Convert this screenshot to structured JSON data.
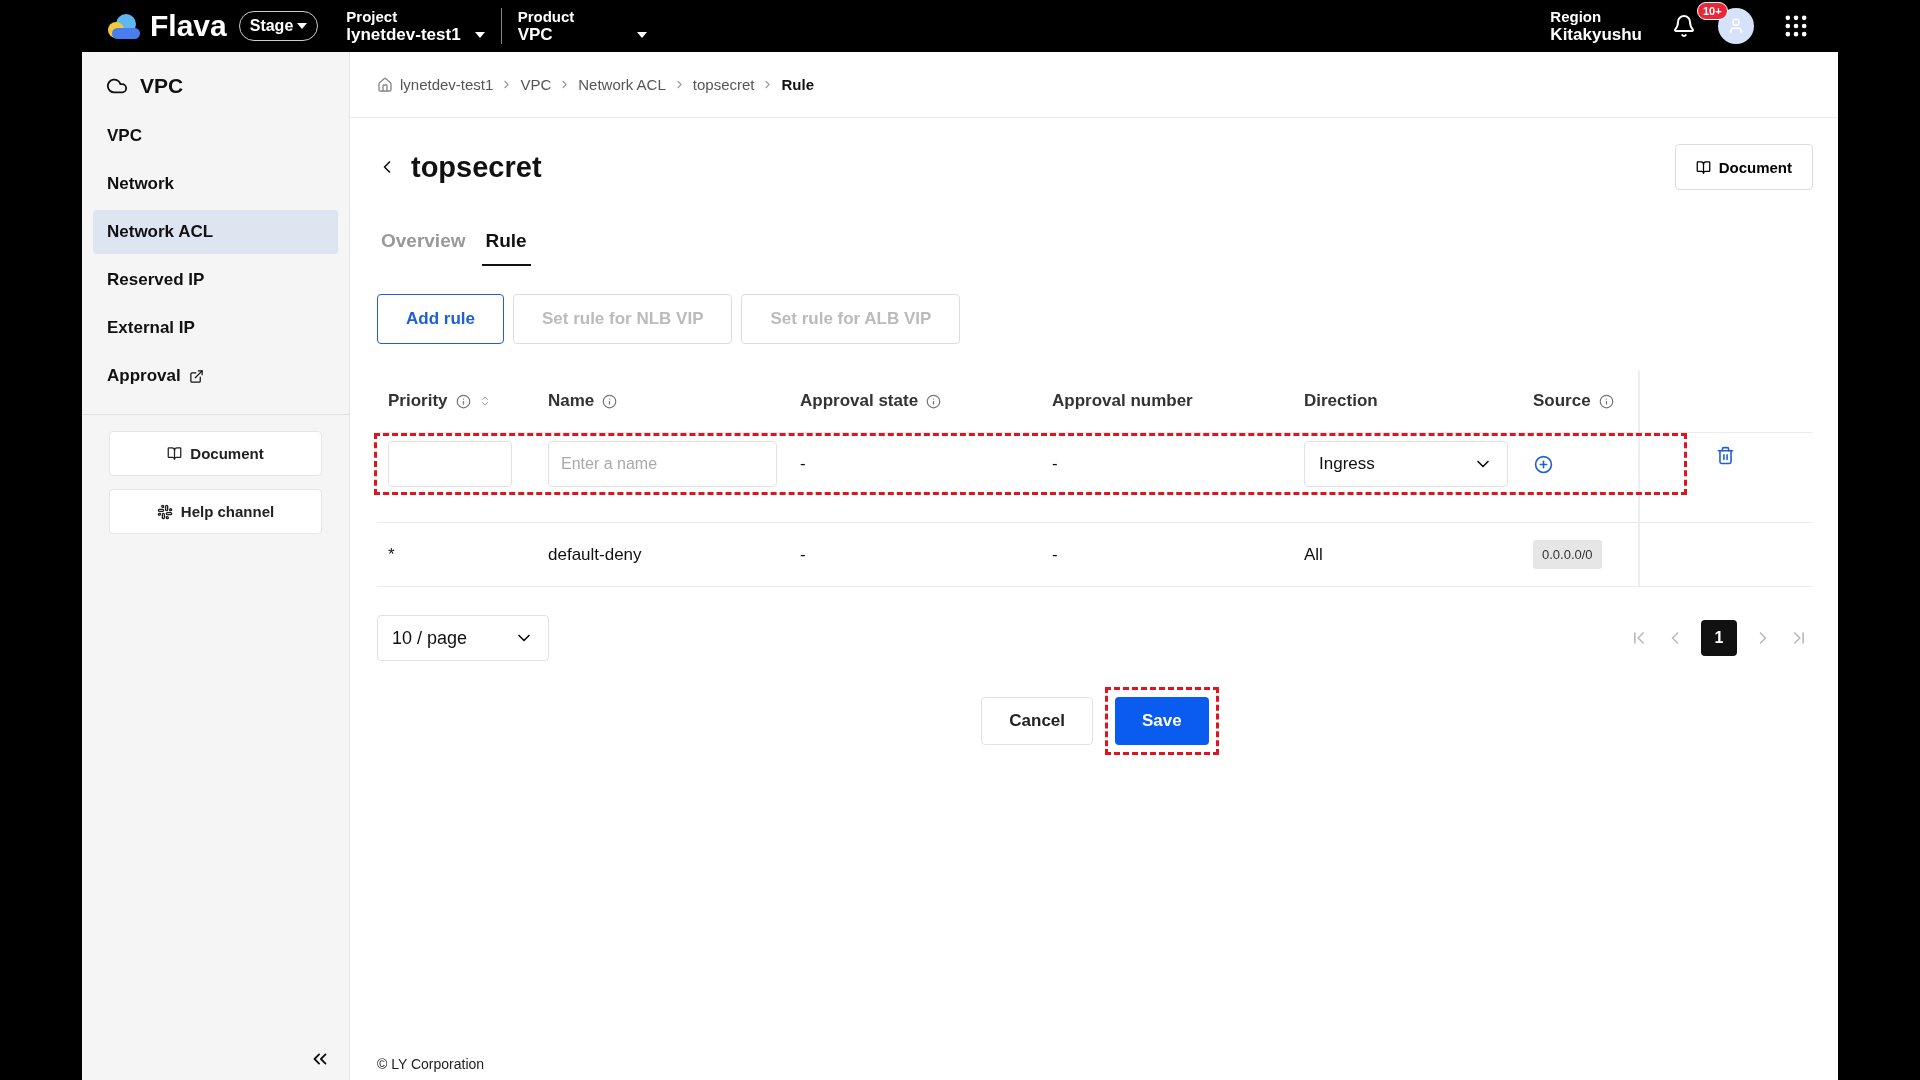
{
  "topbar": {
    "logo": "Flava",
    "env": "Stage",
    "project": {
      "label": "Project",
      "value": "lynetdev-test1"
    },
    "product": {
      "label": "Product",
      "value": "VPC"
    },
    "region": {
      "label": "Region",
      "value": "Kitakyushu"
    },
    "notifications": "10+"
  },
  "sidebar": {
    "title": "VPC",
    "items": [
      {
        "label": "VPC",
        "selected": false,
        "kind": "internal"
      },
      {
        "label": "Network",
        "selected": false,
        "kind": "internal"
      },
      {
        "label": "Network ACL",
        "selected": true,
        "kind": "internal"
      },
      {
        "label": "Reserved IP",
        "selected": false,
        "kind": "internal"
      },
      {
        "label": "External IP",
        "selected": false,
        "kind": "internal"
      },
      {
        "label": "Approval",
        "selected": false,
        "kind": "external"
      }
    ],
    "buttons": [
      {
        "kind": "doc",
        "label": "Document"
      },
      {
        "kind": "help",
        "label": "Help channel"
      }
    ]
  },
  "breadcrumb": [
    "lynetdev-test1",
    "VPC",
    "Network ACL",
    "topsecret",
    "Rule"
  ],
  "title": "topsecret",
  "document_button": "Document",
  "tabs": [
    {
      "label": "Overview",
      "selected": false
    },
    {
      "label": "Rule",
      "selected": true
    }
  ],
  "actions": [
    {
      "label": "Add rule",
      "disabled": false
    },
    {
      "label": "Set rule for NLB VIP",
      "disabled": true
    },
    {
      "label": "Set rule for ALB VIP",
      "disabled": true
    }
  ],
  "table": {
    "columns": [
      {
        "label": "Priority",
        "kind": "sortable"
      },
      {
        "label": "Name",
        "kind": "info"
      },
      {
        "label": "Approval state",
        "kind": "info"
      },
      {
        "label": "Approval number",
        "kind": "plain"
      },
      {
        "label": "Direction",
        "kind": "plain"
      },
      {
        "label": "Source",
        "kind": "info"
      }
    ],
    "rows": [
      {
        "kind": "edit",
        "highlighted": true,
        "name_placeholder": "Enter a name",
        "approval_state": "-",
        "approval_number": "-",
        "direction": "Ingress"
      },
      {
        "kind": "static",
        "highlighted": false,
        "priority": "*",
        "name": "default-deny",
        "approval_state": "-",
        "approval_number": "-",
        "direction": "All",
        "source": "0.0.0.0/0"
      }
    ]
  },
  "pagination": {
    "page_size": "10 / page",
    "pages": [
      {
        "label": "1",
        "selected": true
      }
    ]
  },
  "form_buttons": [
    {
      "kind": "cancel",
      "label": "Cancel",
      "highlighted": false
    },
    {
      "kind": "save",
      "label": "Save",
      "highlighted": true
    }
  ],
  "footer": "© LY Corporation"
}
